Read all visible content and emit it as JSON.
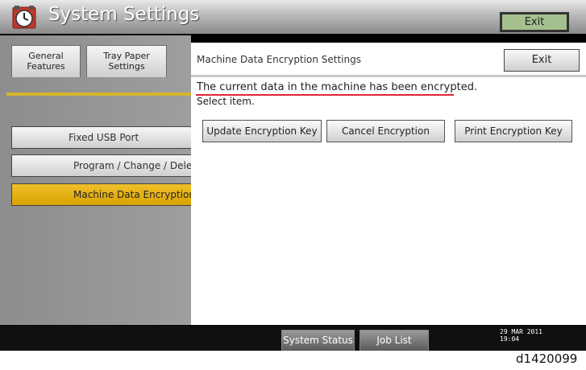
{
  "app": {
    "title": "System Settings",
    "header_exit": "Exit"
  },
  "tabs": [
    {
      "label_line1": "General",
      "label_line2": "Features"
    },
    {
      "label_line1": "Tray Paper",
      "label_line2": "Settings"
    }
  ],
  "menu": {
    "fixed_usb": "Fixed USB Port",
    "program": "Program / Change / Dele",
    "encryption": "Machine Data Encryption"
  },
  "dialog": {
    "title": "Machine Data Encryption Settings",
    "exit": "Exit",
    "message": "The current data in the machine has been encrypted.",
    "instruction": "Select item.",
    "buttons": {
      "update": "Update Encryption Key",
      "cancel": "Cancel Encryption",
      "print": "Print Encryption Key"
    }
  },
  "footer": {
    "system_status": "System Status",
    "job_list": "Job List",
    "date": "29 MAR  2011",
    "time": "19:04"
  },
  "caption": "d1420099",
  "colors": {
    "accent_yellow": "#d9a200",
    "exit_green": "#a4c08e",
    "underline_red": "#e0243a"
  }
}
